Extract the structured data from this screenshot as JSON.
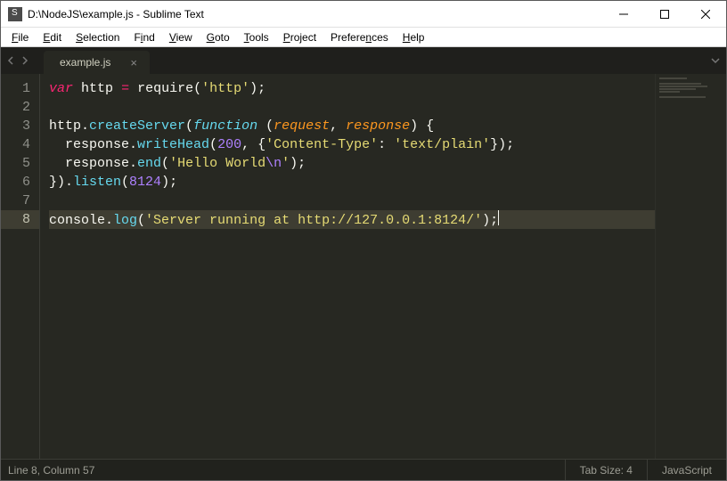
{
  "window": {
    "title": "D:\\NodeJS\\example.js - Sublime Text"
  },
  "menu": {
    "items": [
      {
        "label": "File",
        "ul": "F"
      },
      {
        "label": "Edit",
        "ul": "E"
      },
      {
        "label": "Selection",
        "ul": "S"
      },
      {
        "label": "Find",
        "ul": "i"
      },
      {
        "label": "View",
        "ul": "V"
      },
      {
        "label": "Goto",
        "ul": "G"
      },
      {
        "label": "Tools",
        "ul": "T"
      },
      {
        "label": "Project",
        "ul": "P"
      },
      {
        "label": "Preferences",
        "ul": "n"
      },
      {
        "label": "Help",
        "ul": "H"
      }
    ]
  },
  "tabs": {
    "active": 0,
    "items": [
      {
        "label": "example.js"
      }
    ]
  },
  "editor": {
    "line_numbers": [
      "1",
      "2",
      "3",
      "4",
      "5",
      "6",
      "7",
      "8"
    ],
    "current_line_index": 7,
    "lines_html": [
      "<span class='kw'>var</span> <span class='pln'>http</span> <span class='kw'>=</span> <span class='pln'>require</span>(<span class='str'>'http'</span>);",
      "",
      "<span class='pln'>http.</span><span class='fn'>createServer</span>(<span class='kw2'>function</span> (<span class='prm'>request</span>, <span class='prm'>response</span>) {",
      "  <span class='pln'>response.</span><span class='fn'>writeHead</span>(<span class='num'>200</span>, {<span class='str'>'Content-Type'</span>: <span class='str'>'text/plain'</span>});",
      "  <span class='pln'>response.</span><span class='fn'>end</span>(<span class='str'>'Hello World</span><span class='esc'>\\n</span><span class='str'>'</span>);",
      "}).<span class='fn'>listen</span>(<span class='num'>8124</span>);",
      "",
      "<span class='pln'>console.</span><span class='fn'>log</span>(<span class='str'>'Server running at http://127.0.0.1:8124/'</span>);<span class='cursor'></span>"
    ]
  },
  "status": {
    "position": "Line 8, Column 57",
    "tab_size": "Tab Size: 4",
    "syntax": "JavaScript"
  }
}
